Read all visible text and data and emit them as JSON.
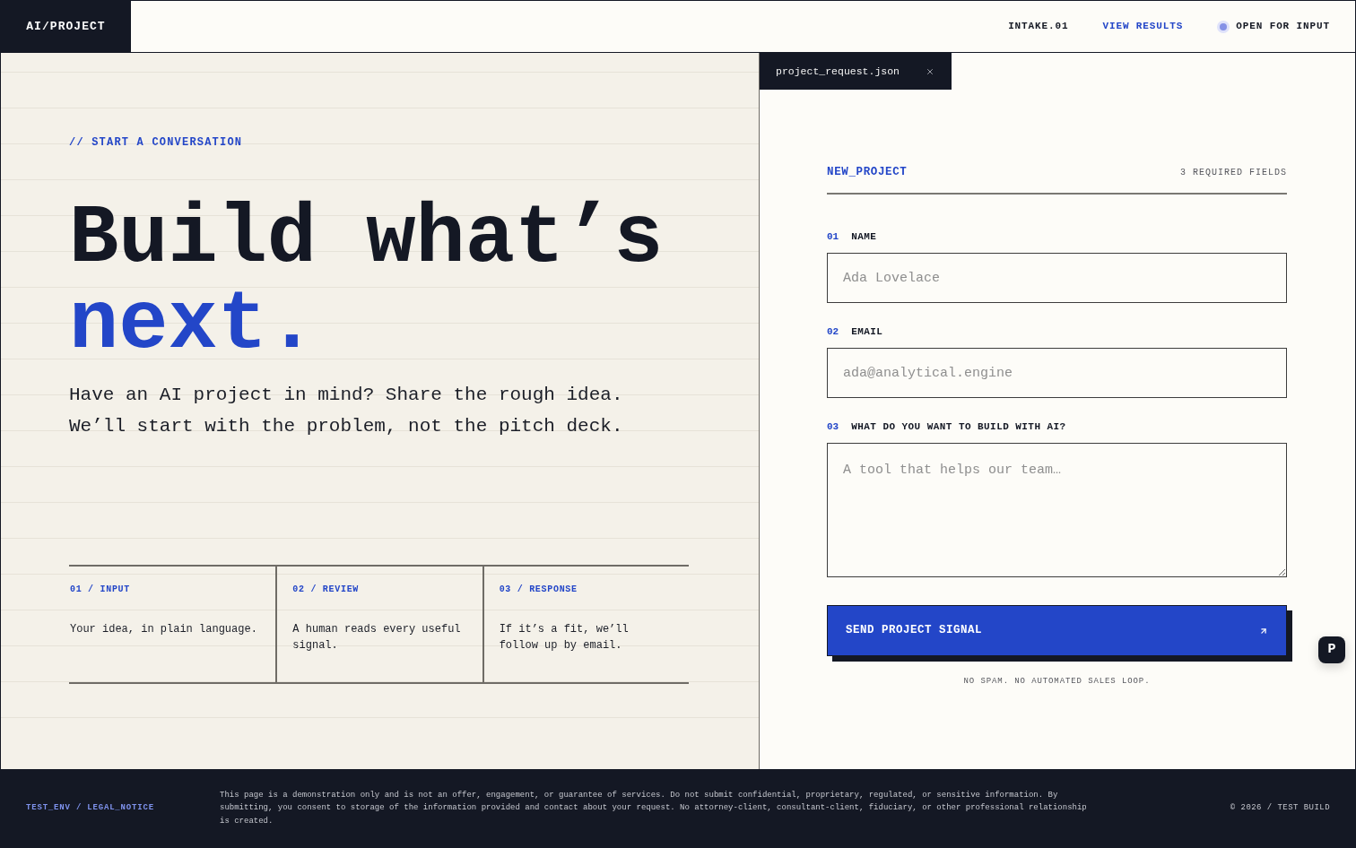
{
  "header": {
    "logo": "AI/PROJECT",
    "nav": [
      {
        "kind": "text",
        "label": "INTAKE.01"
      },
      {
        "kind": "link",
        "label": "VIEW RESULTS"
      }
    ],
    "status": {
      "label": "OPEN FOR INPUT",
      "on": true
    }
  },
  "intro": {
    "eyebrow": "// START A CONVERSATION",
    "headline": "Build what’s",
    "headline_accent": "next.",
    "lede": "Have an AI project in mind? Share the rough idea. We’ll start with the problem, not the pitch deck.",
    "steps": [
      {
        "label": "01 / INPUT",
        "text": "Your idea, in plain language."
      },
      {
        "label": "02 / REVIEW",
        "text": "A human reads every useful signal."
      },
      {
        "label": "03 / RESPONSE",
        "text": "If it’s a fit, we’ll follow up by email."
      }
    ]
  },
  "form_panel": {
    "tab": {
      "label": "project_request.json",
      "selected": true
    },
    "title": "NEW_PROJECT",
    "required_note": "3 REQUIRED FIELDS",
    "fields": [
      {
        "kind": "text",
        "number": "01",
        "label": "NAME",
        "placeholder": "Ada Lovelace"
      },
      {
        "kind": "email",
        "number": "02",
        "label": "EMAIL",
        "placeholder": "ada@analytical.engine"
      },
      {
        "kind": "textarea",
        "number": "03",
        "label": "WHAT DO YOU WANT TO BUILD WITH AI?",
        "placeholder": "A tool that helps our team…"
      }
    ],
    "submit": "SEND PROJECT SIGNAL",
    "disclaimer": "NO SPAM. NO AUTOMATED SALES LOOP."
  },
  "chat_widget": {
    "label": "P"
  },
  "footer": {
    "legal_link": "TEST_ENV / LEGAL_NOTICE",
    "notice": "This page is a demonstration only and is not an offer, engagement, or guarantee of services. Do not submit confidential, proprietary, regulated, or sensitive information. By submitting, you consent to storage of the information provided and contact about your request. No attorney-client, consultant-client, fiduciary, or other professional relationship is created.",
    "copyright": "© 2026 / TEST BUILD"
  }
}
